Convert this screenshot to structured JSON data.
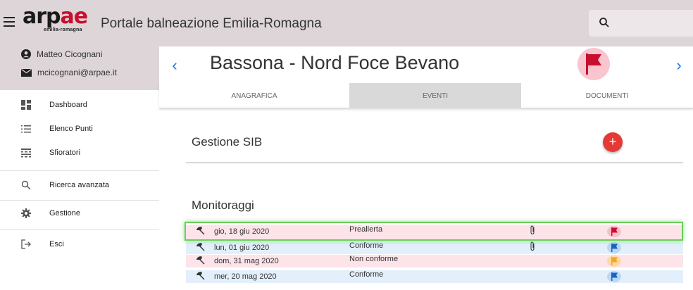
{
  "topbar": {
    "logo_text": "arpae",
    "logo_sub": "emilia-romagna",
    "title": "Portale balneazione Emilia-Romagna",
    "menu_icon": "hamburger-icon",
    "search_icon": "search-icon"
  },
  "user": {
    "name": "Matteo Cicognani",
    "email": "mcicognani@arpae.it"
  },
  "sidebar": {
    "items": [
      {
        "label": "Dashboard",
        "icon": "dashboard-icon"
      },
      {
        "label": "Elenco Punti",
        "icon": "list-icon"
      },
      {
        "label": "Sfioratori",
        "icon": "overflow-icon"
      },
      {
        "label": "Ricerca avanzata",
        "icon": "search-icon"
      },
      {
        "label": "Gestione",
        "icon": "gear-icon"
      },
      {
        "label": "Esci",
        "icon": "logout-icon"
      }
    ]
  },
  "header": {
    "beach_name": "Bassona - Nord Foce Bevano",
    "prev_label": "‹",
    "next_label": "›",
    "status_flag_color": "#c8102e"
  },
  "tabs": [
    {
      "label": "ANAGRAFICA",
      "active": false
    },
    {
      "label": "EVENTI",
      "active": true
    },
    {
      "label": "DOCUMENTI",
      "active": false
    }
  ],
  "gestione": {
    "title": "Gestione SIB",
    "add_label": "+"
  },
  "monitoraggi": {
    "title": "Monitoraggi",
    "rows": [
      {
        "date": "gio, 18 giu 2020",
        "stato": "Preallerta",
        "attachment": true,
        "flag_color": "#c8102e",
        "row_color": "pink",
        "dot_bg": "#f8bfc9"
      },
      {
        "date": "lun, 01 giu 2020",
        "stato": "Conforme",
        "attachment": true,
        "flag_color": "#1565c0",
        "row_color": "blue",
        "dot_bg": "#bcd6f3"
      },
      {
        "date": "dom, 31 mag 2020",
        "stato": "Non conforme",
        "attachment": false,
        "flag_color": "#f5a623",
        "row_color": "pink",
        "dot_bg": "#fbd9a6"
      },
      {
        "date": "mer, 20 mag 2020",
        "stato": "Conforme",
        "attachment": false,
        "flag_color": "#1565c0",
        "row_color": "blue",
        "dot_bg": "#bcd6f3"
      }
    ]
  }
}
